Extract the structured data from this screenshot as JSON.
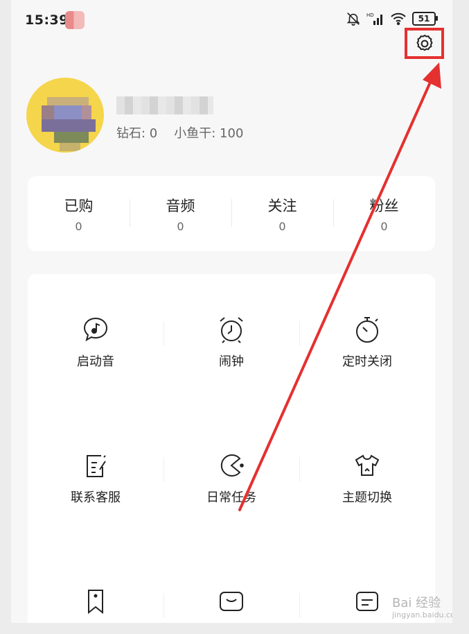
{
  "status_bar": {
    "time": "15:39",
    "battery": "51",
    "icons": [
      "mute-bell-icon",
      "hd-signal-icon",
      "wifi-icon",
      "battery-icon"
    ]
  },
  "header": {
    "settings_icon": "gear-icon",
    "highlight_color": "#e53030"
  },
  "profile": {
    "currency_text": "钻石: 0  小鱼干: 100",
    "diamond": "钻石: 0",
    "fish": "小鱼干: 100"
  },
  "stats": [
    {
      "label": "已购",
      "value": "0"
    },
    {
      "label": "音频",
      "value": "0"
    },
    {
      "label": "关注",
      "value": "0"
    },
    {
      "label": "粉丝",
      "value": "0"
    }
  ],
  "features": [
    {
      "label": "启动音",
      "icon": "music-bubble-icon"
    },
    {
      "label": "闹钟",
      "icon": "alarm-clock-icon"
    },
    {
      "label": "定时关闭",
      "icon": "stopwatch-icon"
    },
    {
      "label": "联系客服",
      "icon": "edit-note-icon"
    },
    {
      "label": "日常任务",
      "icon": "pacman-icon"
    },
    {
      "label": "主题切换",
      "icon": "tshirt-icon"
    },
    {
      "label": "",
      "icon": "bookmark-icon"
    },
    {
      "label": "",
      "icon": "mail-icon"
    },
    {
      "label": "",
      "icon": "share-icon"
    }
  ],
  "watermark": {
    "brand": "Bai 经验",
    "url": "jingyan.baidu.com"
  },
  "colors": {
    "accent": "#e53030",
    "background": "#f7f7f7",
    "card": "#ffffff"
  }
}
